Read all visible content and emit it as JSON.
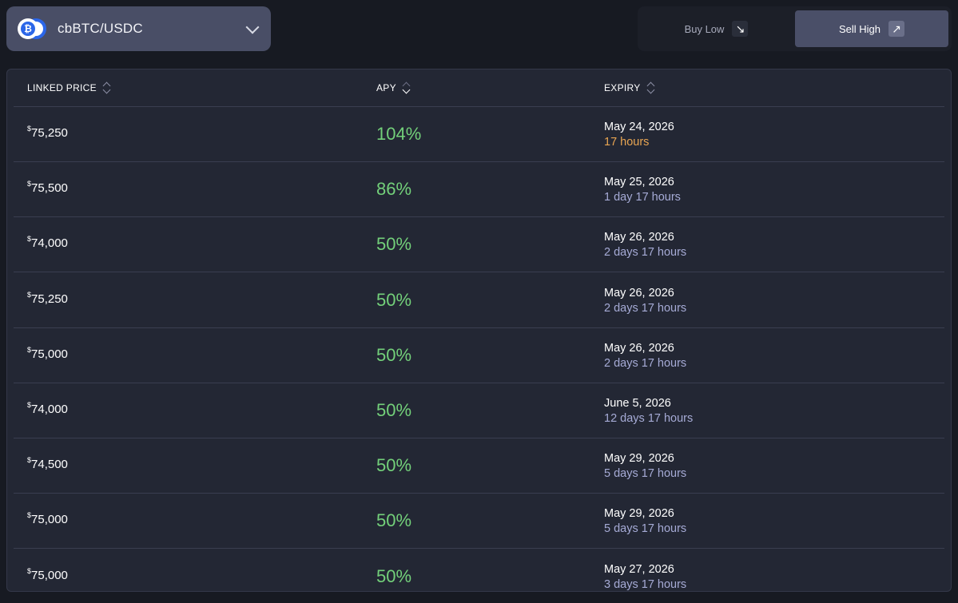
{
  "pair_selector": {
    "label": "cbBTC/USDC",
    "icon": "bitcoin-icon"
  },
  "mode_toggle": {
    "buy_label": "Buy Low",
    "buy_icon": "↘",
    "sell_label": "Sell High",
    "sell_icon": "↗",
    "active": "Sell High"
  },
  "table": {
    "headers": {
      "price": "LINKED PRICE",
      "apy": "APY",
      "expiry": "EXPIRY"
    },
    "currency_symbol": "$",
    "rows": [
      {
        "price": "75,250",
        "apy": "104%",
        "date": "May 24, 2026",
        "remaining": "17 hours"
      },
      {
        "price": "75,500",
        "apy": "86%",
        "date": "May 25, 2026",
        "remaining": "1 day 17 hours"
      },
      {
        "price": "74,000",
        "apy": "50%",
        "date": "May 26, 2026",
        "remaining": "2 days 17 hours"
      },
      {
        "price": "75,250",
        "apy": "50%",
        "date": "May 26, 2026",
        "remaining": "2 days 17 hours"
      },
      {
        "price": "75,000",
        "apy": "50%",
        "date": "May 26, 2026",
        "remaining": "2 days 17 hours"
      },
      {
        "price": "74,000",
        "apy": "50%",
        "date": "June 5, 2026",
        "remaining": "12 days 17 hours"
      },
      {
        "price": "74,500",
        "apy": "50%",
        "date": "May 29, 2026",
        "remaining": "5 days 17 hours"
      },
      {
        "price": "75,000",
        "apy": "50%",
        "date": "May 29, 2026",
        "remaining": "5 days 17 hours"
      },
      {
        "price": "75,000",
        "apy": "50%",
        "date": "May 27, 2026",
        "remaining": "3 days 17 hours"
      }
    ]
  },
  "colors": {
    "background": "#171a22",
    "panel": "#232734",
    "apy_green": "#73d07a",
    "expiry_soon": "#e8a552",
    "expiry_normal": "#a6abd6"
  }
}
